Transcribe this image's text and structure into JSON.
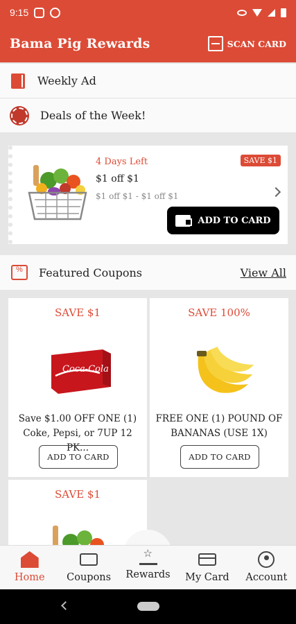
{
  "status": {
    "time": "9:15"
  },
  "app": {
    "title": "Bama Pig Rewards",
    "scan_label": "SCAN CARD"
  },
  "links": {
    "weekly_ad": "Weekly Ad",
    "deals": "Deals of the Week!"
  },
  "deal": {
    "days_left": "4 Days Left",
    "badge": "SAVE $1",
    "title": "$1 off $1",
    "subtitle": "$1 off $1 - $1 off $1",
    "add_label": "ADD TO CARD"
  },
  "featured": {
    "title": "Featured Coupons",
    "view_all": "View All"
  },
  "coupons": [
    {
      "save": "SAVE $1",
      "desc_line1": "Save $1.00 OFF ONE (1)",
      "desc_line2": "Coke, Pepsi, or 7UP 12 PK...",
      "button": "ADD TO CARD"
    },
    {
      "save": "SAVE 100%",
      "desc_line1": "FREE ONE (1) POUND OF",
      "desc_line2": "BANANAS (USE 1X)",
      "button": "ADD TO CARD"
    },
    {
      "save": "SAVE $1"
    }
  ],
  "nav": {
    "home": "Home",
    "coupons": "Coupons",
    "rewards": "Rewards",
    "card": "My Card",
    "account": "Account"
  },
  "colors": {
    "brand": "#dc4b36",
    "nav_active": "#dc4b36"
  },
  "icons": [
    "scan-card-icon",
    "book-icon",
    "deals-badge-icon",
    "wallet-icon",
    "coupon-scissors-icon",
    "home-icon",
    "coupons-icon",
    "rewards-icon",
    "card-icon",
    "account-icon"
  ]
}
